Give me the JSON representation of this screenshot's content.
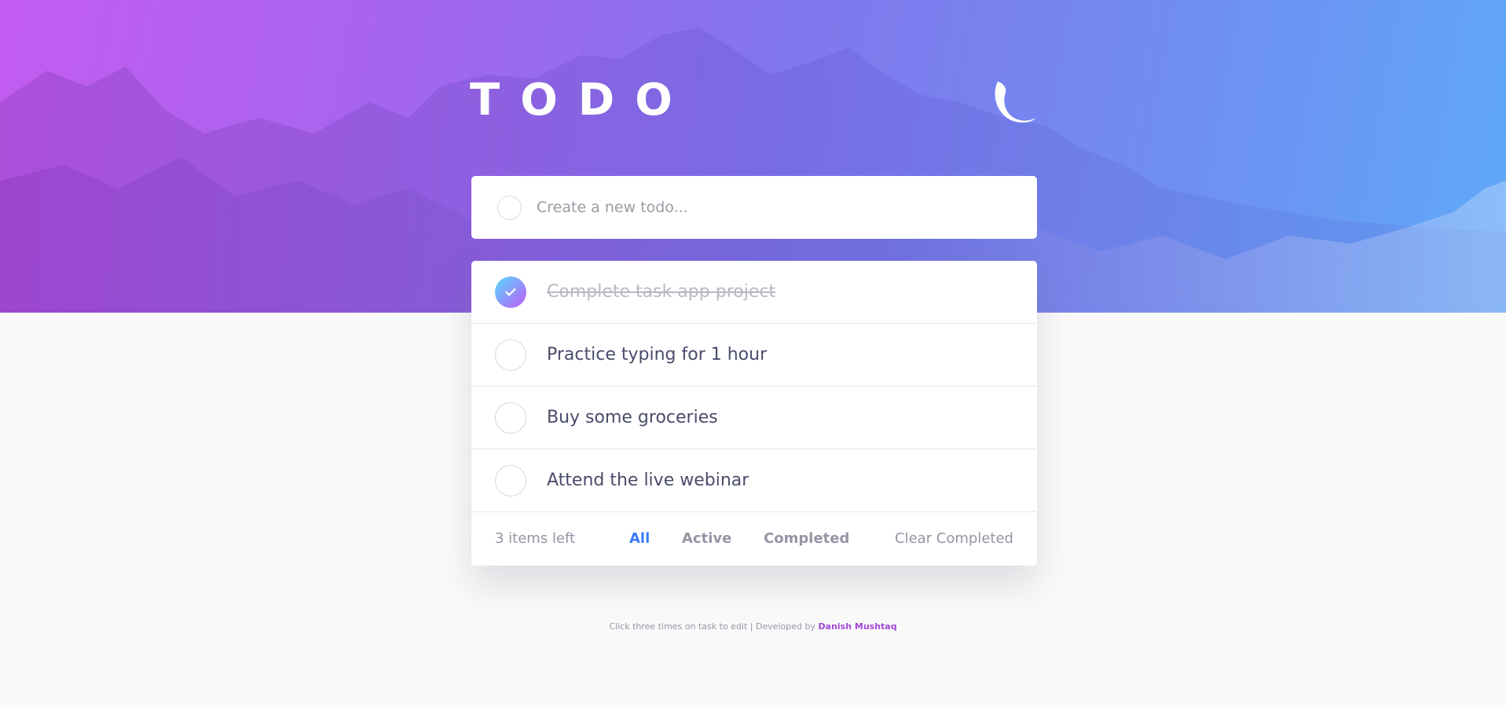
{
  "header": {
    "title": "TODO",
    "theme_toggle_icon": "moon-icon"
  },
  "new_todo": {
    "placeholder": "Create a new todo..."
  },
  "todos": [
    {
      "text": "Complete task app project",
      "completed": true
    },
    {
      "text": "Practice typing for 1 hour",
      "completed": false
    },
    {
      "text": "Buy some groceries",
      "completed": false
    },
    {
      "text": "Attend the live webinar",
      "completed": false
    }
  ],
  "footer": {
    "items_left": "3 items left",
    "filters": [
      {
        "label": "All",
        "active": true
      },
      {
        "label": "Active",
        "active": false
      },
      {
        "label": "Completed",
        "active": false
      }
    ],
    "clear_label": "Clear Completed"
  },
  "attribution": {
    "text": "Click three times on task to edit | Developed by",
    "author": "Danish Mushtaq"
  },
  "colors": {
    "gradient_start": "#55ddff",
    "gradient_end": "#c058f3",
    "active_filter": "#3a7cfd",
    "author_link": "#a347d8"
  }
}
